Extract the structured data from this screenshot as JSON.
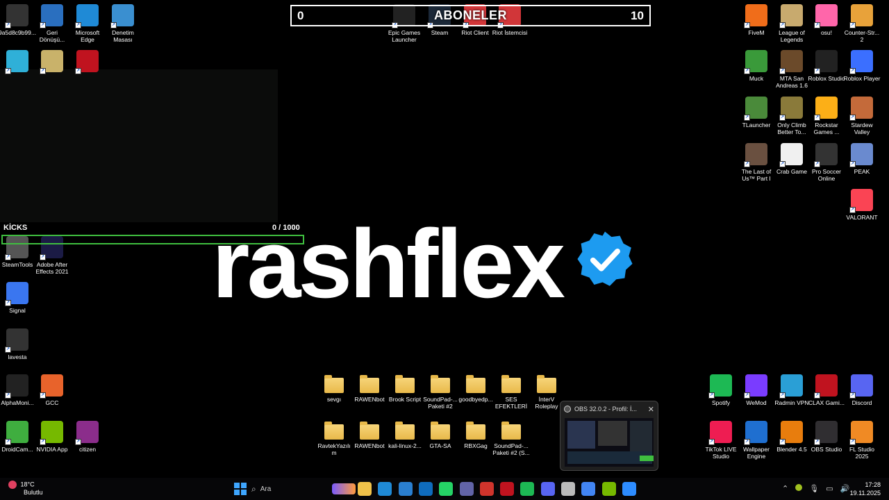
{
  "overlay": {
    "subscribers_title": "ABONELER",
    "subscribers_current": "0",
    "subscribers_goal": "10",
    "kicks_label": "KİCKS",
    "kicks_count": "0  / 1000",
    "kicks_progress": 0,
    "streamer_name": "rashflex",
    "accent_green": "#3fbf3f",
    "verified_color": "#1d9bf0"
  },
  "desktop_icons_left": [
    {
      "label": "9a5d8c9b99...",
      "icon": "lavesta-logo-icon",
      "color": "#333333"
    },
    {
      "label": "Geri Dönüşü...",
      "icon": "recycle-bin-icon",
      "color": "#2a6fbf"
    },
    {
      "label": "Microsoft Edge",
      "icon": "edge-icon",
      "color": "#1f8ad6"
    },
    {
      "label": "Denetim Masası",
      "icon": "control-panel-icon",
      "color": "#3a8fd0"
    },
    {
      "label": "",
      "icon": "monitor-icon",
      "color": "#2fb0d8"
    },
    {
      "label": "",
      "icon": "notepad-icon",
      "color": "#c9b26a"
    },
    {
      "label": "",
      "icon": "opera-icon",
      "color": "#c0131f"
    },
    {
      "label": "SteamTools",
      "icon": "steamtools-icon",
      "color": "#555555"
    },
    {
      "label": "Adobe After Effects 2021",
      "icon": "after-effects-icon",
      "color": "#1b1b45"
    },
    {
      "label": "Signal",
      "icon": "signal-icon",
      "color": "#3a76f0"
    },
    {
      "label": "lavesta",
      "icon": "lavesta-logo-icon",
      "color": "#333333"
    },
    {
      "label": "AlphaMoni...",
      "icon": "alphamoni-icon",
      "color": "#222222"
    },
    {
      "label": "GCC",
      "icon": "gcc-icon",
      "color": "#e8632b"
    },
    {
      "label": "DroidCam...",
      "icon": "droidcam-icon",
      "color": "#3fae3f"
    },
    {
      "label": "NVIDIA App",
      "icon": "nvidia-icon",
      "color": "#76b900"
    },
    {
      "label": "citizen",
      "icon": "winrar-icon",
      "color": "#8b2d8b"
    }
  ],
  "desktop_icons_top_center": [
    {
      "label": "Epic Games Launcher",
      "icon": "epic-games-icon",
      "color": "#222222"
    },
    {
      "label": "Steam",
      "icon": "steam-icon",
      "color": "#1b2838"
    },
    {
      "label": "Riot Client",
      "icon": "riot-client-icon",
      "color": "#d13639"
    },
    {
      "label": "Riot İstemcisi",
      "icon": "riot-client-icon",
      "color": "#d13639"
    }
  ],
  "desktop_icons_right": [
    {
      "label": "FiveM",
      "icon": "fivem-icon",
      "color": "#f06d1a"
    },
    {
      "label": "League of Legends",
      "icon": "lol-icon",
      "color": "#c8aa6e"
    },
    {
      "label": "osu!",
      "icon": "osu-icon",
      "color": "#ff66aa"
    },
    {
      "label": "Counter-Str... 2",
      "icon": "cs2-icon",
      "color": "#e8a23a"
    },
    {
      "label": "Muck",
      "icon": "muck-icon",
      "color": "#3a9a3a"
    },
    {
      "label": "MTA San Andreas 1.6",
      "icon": "mta-icon",
      "color": "#6b4a2a"
    },
    {
      "label": "Roblox Studio",
      "icon": "roblox-studio-icon",
      "color": "#222222"
    },
    {
      "label": "Roblox Player",
      "icon": "roblox-icon",
      "color": "#3b6fff"
    },
    {
      "label": "TLauncher",
      "icon": "tlauncher-icon",
      "color": "#4a8a3a"
    },
    {
      "label": "Only Climb Better To...",
      "icon": "only-climb-icon",
      "color": "#8a7a3a"
    },
    {
      "label": "Rockstar Games ...",
      "icon": "rockstar-icon",
      "color": "#fcaf17"
    },
    {
      "label": "Stardew Valley",
      "icon": "stardew-icon",
      "color": "#c46a3a"
    },
    {
      "label": "The Last of Us™ Part I",
      "icon": "tlou-icon",
      "color": "#6a5040"
    },
    {
      "label": "Crab Game",
      "icon": "crab-game-icon",
      "color": "#f0f0f0"
    },
    {
      "label": "Pro Soccer Online",
      "icon": "soccer-icon",
      "color": "#333333"
    },
    {
      "label": "PEAK",
      "icon": "peak-icon",
      "color": "#6a8acf"
    },
    {
      "label": "VALORANT",
      "icon": "valorant-icon",
      "color": "#fa4454"
    },
    {
      "label": "Spotify",
      "icon": "spotify-icon",
      "color": "#1db954"
    },
    {
      "label": "WeMod",
      "icon": "wemod-icon",
      "color": "#7a3cff"
    },
    {
      "label": "Radmin VPN",
      "icon": "radmin-icon",
      "color": "#2a9fd6"
    },
    {
      "label": "CLAX Gami...",
      "icon": "clax-icon",
      "color": "#c0131f"
    },
    {
      "label": "Discord",
      "icon": "discord-icon",
      "color": "#5865f2"
    },
    {
      "label": "TikTok LIVE Studio",
      "icon": "tiktok-icon",
      "color": "#ee1d52"
    },
    {
      "label": "Wallpaper Engine",
      "icon": "wallpaper-engine-icon",
      "color": "#1f6fd0"
    },
    {
      "label": "Blender 4.5",
      "icon": "blender-icon",
      "color": "#e87d0d"
    },
    {
      "label": "OBS Studio",
      "icon": "obs-icon",
      "color": "#302e31"
    },
    {
      "label": "FL Studio 2025",
      "icon": "fl-studio-icon",
      "color": "#f08a24"
    }
  ],
  "folders_row1": [
    {
      "label": "sevgı"
    },
    {
      "label": "RAWENbot"
    },
    {
      "label": "Brook Script"
    },
    {
      "label": "SoundPad-... Paketi #2"
    },
    {
      "label": "goodbyedp..."
    },
    {
      "label": "SES EFEKTLERİ"
    },
    {
      "label": "İnterV Roleplay"
    }
  ],
  "folders_row2": [
    {
      "label": "RavtekYazılım"
    },
    {
      "label": "RAWENbot"
    },
    {
      "label": "kali-linux-2..."
    },
    {
      "label": "GTA-SA"
    },
    {
      "label": "RBXGag"
    },
    {
      "label": "SoundPad-... Paketi #2 (S..."
    }
  ],
  "obs_window": {
    "title": "OBS 32.0.2 - Profil: İ..."
  },
  "taskbar": {
    "weather_temp": "18°C",
    "weather_desc": "Bulutlu",
    "search_placeholder": "Ara",
    "time": "17:28",
    "date": "19.11.2025",
    "pinned": [
      {
        "icon": "file-explorer-icon",
        "color": "#f0c24a"
      },
      {
        "icon": "edge-icon",
        "color": "#1f8ad6"
      },
      {
        "icon": "store-icon",
        "color": "#2a7fd0"
      },
      {
        "icon": "outlook-icon",
        "color": "#0f6cbd"
      },
      {
        "icon": "whatsapp-icon",
        "color": "#25d366"
      },
      {
        "icon": "teams-icon",
        "color": "#6264a7"
      },
      {
        "icon": "wemod-icon",
        "color": "#d0342c"
      },
      {
        "icon": "opera-icon",
        "color": "#c0131f"
      },
      {
        "icon": "spotify-icon",
        "color": "#1db954"
      },
      {
        "icon": "discord-icon",
        "color": "#5865f2"
      },
      {
        "icon": "notepad-icon",
        "color": "#bbbbbb"
      },
      {
        "icon": "chrome-icon",
        "color": "#4285f4"
      },
      {
        "icon": "nvidia-icon",
        "color": "#76b900"
      },
      {
        "icon": "zoom-icon",
        "color": "#2d8cff"
      }
    ]
  }
}
